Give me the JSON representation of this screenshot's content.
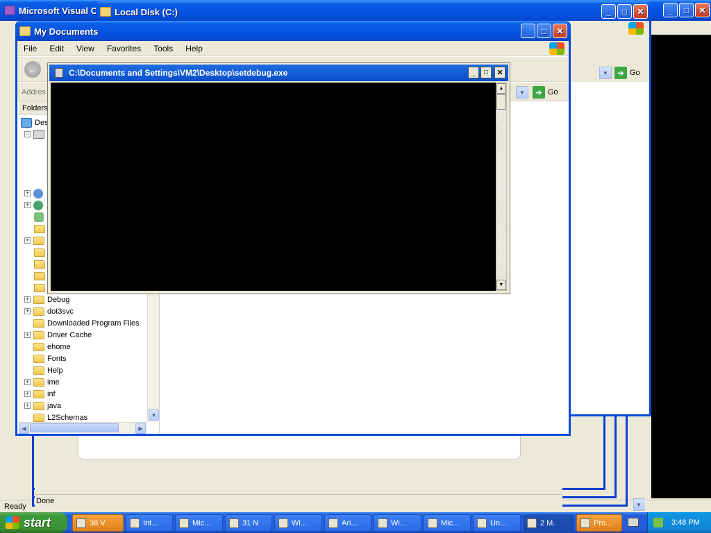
{
  "windows": {
    "visual_studio": {
      "title": "Microsoft Visual C",
      "status": "Ready"
    },
    "local_disk": {
      "title": "Local Disk (C:)",
      "go_label": "Go",
      "status": "Done"
    },
    "my_documents": {
      "title": "My Documents",
      "menu": [
        "File",
        "Edit",
        "View",
        "Favorites",
        "Tools",
        "Help"
      ],
      "address_label": "Addres",
      "go_label": "Go",
      "folders_label": "Folders",
      "tree_top": "Des",
      "tree_items": [
        {
          "label": "Debug",
          "expandable": true
        },
        {
          "label": "dot3svc",
          "expandable": true
        },
        {
          "label": "Downloaded Program Files",
          "expandable": false
        },
        {
          "label": "Driver Cache",
          "expandable": true
        },
        {
          "label": "ehome",
          "expandable": false
        },
        {
          "label": "Fonts",
          "expandable": false
        },
        {
          "label": "Help",
          "expandable": false
        },
        {
          "label": "ime",
          "expandable": true
        },
        {
          "label": "inf",
          "expandable": true
        },
        {
          "label": "java",
          "expandable": true
        },
        {
          "label": "L2Schemas",
          "expandable": false
        }
      ]
    },
    "console": {
      "title": "C:\\Documents and Settings\\VM2\\Desktop\\setdebug.exe"
    }
  },
  "taskbar": {
    "start_label": "start",
    "tasks": [
      {
        "label": "38 V",
        "style": "orange"
      },
      {
        "label": "Int...",
        "style": "normal"
      },
      {
        "label": "Mic...",
        "style": "normal"
      },
      {
        "label": "31 N",
        "style": "normal"
      },
      {
        "label": "Wi...",
        "style": "normal"
      },
      {
        "label": "Ari...",
        "style": "normal"
      },
      {
        "label": "Wi...",
        "style": "normal"
      },
      {
        "label": "Mic...",
        "style": "normal"
      },
      {
        "label": "Un...",
        "style": "normal"
      },
      {
        "label": "2 M.",
        "style": "active"
      },
      {
        "label": "Pro...",
        "style": "orange"
      }
    ],
    "clock": "3:48 PM"
  }
}
